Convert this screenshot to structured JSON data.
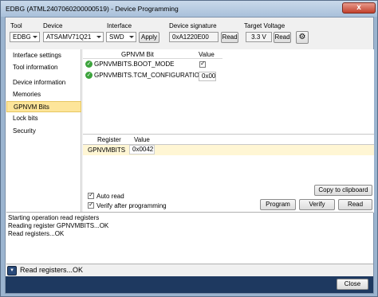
{
  "window": {
    "title": "EDBG (ATML2407060200000519) - Device Programming",
    "close_glyph": "x"
  },
  "toolbar": {
    "tool_label": "Tool",
    "tool_value": "EDBG",
    "device_label": "Device",
    "device_value": "ATSAMV71Q21",
    "interface_label": "Interface",
    "interface_value": "SWD",
    "apply_label": "Apply",
    "signature_label": "Device signature",
    "signature_value": "0xA1220E00",
    "read_label": "Read",
    "voltage_label": "Target Voltage",
    "voltage_value": "3.3 V",
    "read2_label": "Read",
    "settings_icon": "gear-icon"
  },
  "sidebar": {
    "items": [
      {
        "label": "Interface settings"
      },
      {
        "label": "Tool information"
      },
      {
        "label": "Device information"
      },
      {
        "label": "Memories"
      },
      {
        "label": "GPNVM Bits"
      },
      {
        "label": "Lock bits"
      },
      {
        "label": "Security"
      }
    ],
    "selected": "GPNVM Bits"
  },
  "gpnvm": {
    "col_bit": "GPNVM Bit",
    "col_value": "Value",
    "rows": [
      {
        "name": "GPNVMBITS.BOOT_MODE",
        "checked": true
      },
      {
        "name": "GPNVMBITS.TCM_CONFIGURATION",
        "value": "0x00"
      }
    ]
  },
  "registers": {
    "col_register": "Register",
    "col_value": "Value",
    "rows": [
      {
        "name": "GPNVMBITS",
        "value": "0x0042"
      }
    ]
  },
  "options": {
    "auto_read": "Auto read",
    "verify_after": "Verify after programming"
  },
  "actions": {
    "copy": "Copy to clipboard",
    "program": "Program",
    "verify": "Verify",
    "read": "Read"
  },
  "log": {
    "lines": [
      "Starting operation read registers",
      "Reading register GPNVMBITS...OK",
      "Read registers...OK"
    ]
  },
  "status": {
    "text": "Read registers...OK"
  },
  "footer": {
    "close": "Close"
  },
  "colors": {
    "selected": "#fde59a",
    "footer": "#1e3960",
    "title_bar": "#b9cde3"
  }
}
